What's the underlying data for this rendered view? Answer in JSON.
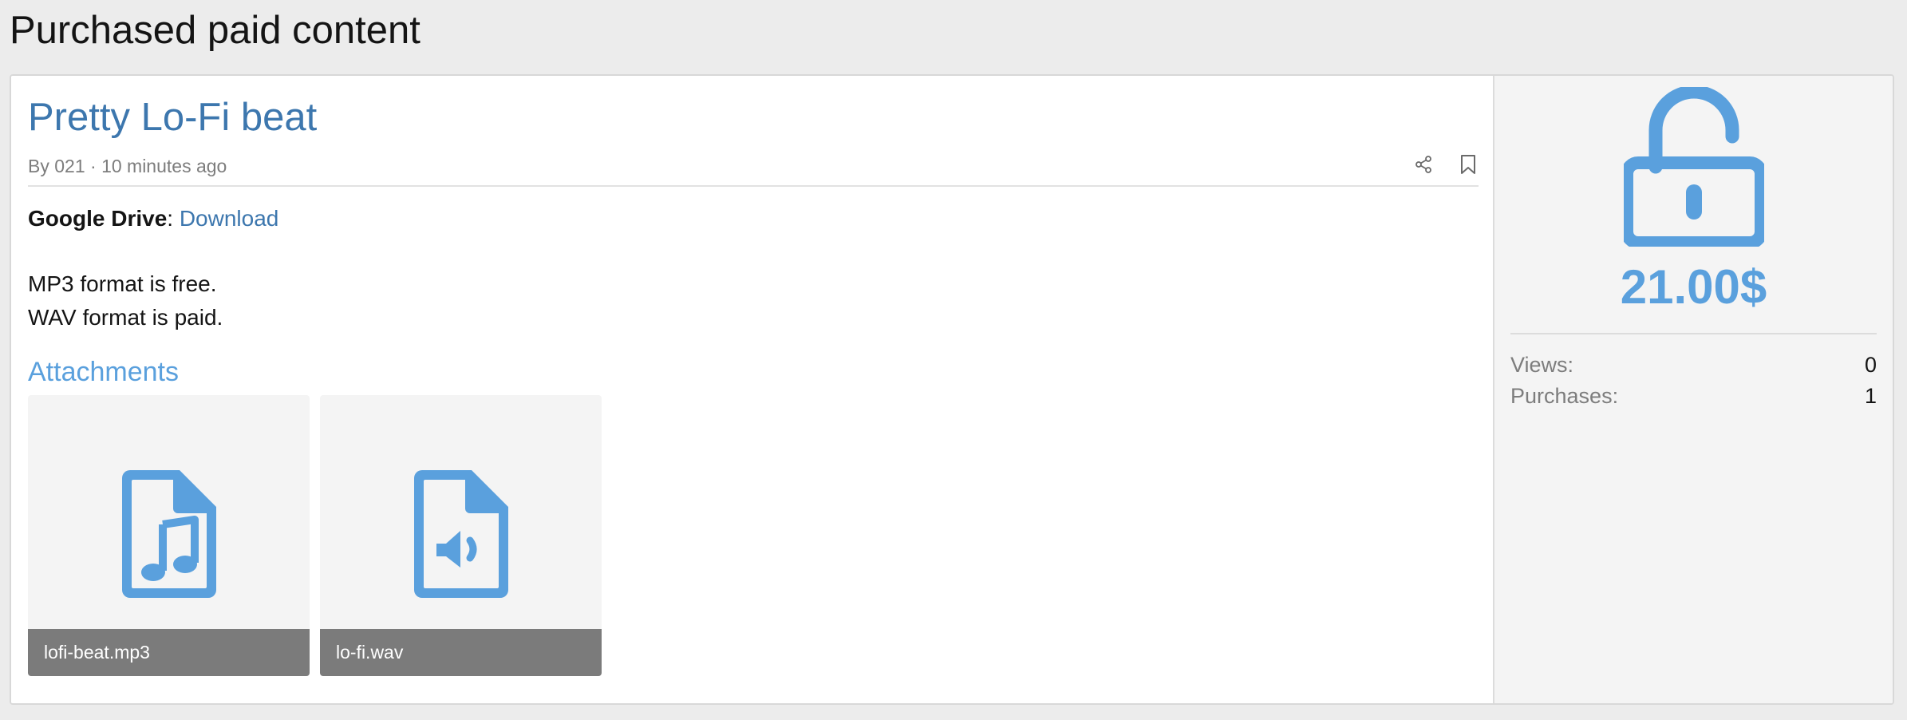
{
  "page": {
    "title": "Purchased paid content"
  },
  "item": {
    "title": "Pretty Lo-Fi beat",
    "meta_by": "By 021",
    "meta_sep": " · ",
    "meta_time": "10 minutes ago",
    "actions": {
      "share_icon": "share-icon",
      "bookmark_icon": "bookmark-icon"
    }
  },
  "content": {
    "drive_label": "Google Drive",
    "drive_colon": ":",
    "download_link": "Download",
    "line1": "MP3 format is free.",
    "line2": "WAV format is paid."
  },
  "attachments": {
    "heading": "Attachments",
    "files": [
      {
        "name": "lofi-beat.mp3",
        "icon": "file-audio-music-icon"
      },
      {
        "name": "lo-fi.wav",
        "icon": "file-audio-speaker-icon"
      }
    ]
  },
  "sidebar": {
    "icon": "unlock-icon",
    "price": "21.00$",
    "stats": [
      {
        "label": "Views:",
        "value": "0"
      },
      {
        "label": "Purchases:",
        "value": "1"
      }
    ]
  },
  "colors": {
    "accent": "#5aa0dd",
    "link": "#3d77ae",
    "caption_bg": "#7b7b7b",
    "page_bg": "#ececec"
  }
}
